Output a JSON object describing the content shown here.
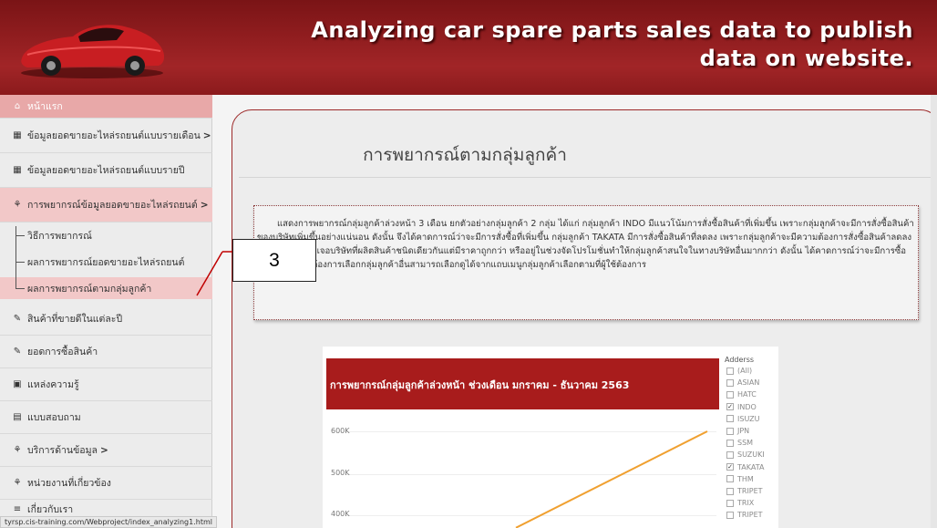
{
  "header": {
    "title_line1": "Analyzing car spare parts sales data to publish",
    "title_line2": "data on website."
  },
  "sidebar": {
    "items": [
      {
        "label": "หน้าแรก",
        "icon": "home-icon"
      },
      {
        "label": "ข้อมูลยอดขายอะไหล่รถยนต์แบบรายเดือน",
        "icon": "calendar-icon",
        "chevron": ">"
      },
      {
        "label": "ข้อมูลยอดขายอะไหล่รถยนต์แบบรายปี",
        "icon": "calendar-icon"
      },
      {
        "label": "การพยากรณ์ข้อมูลยอดขายอะไหล่รถยนต์",
        "icon": "sitemap-icon",
        "chevron": ">"
      },
      {
        "label": "สินค้าที่ขายดีในแต่ละปี",
        "icon": "wrench-icon"
      },
      {
        "label": "ยอดการซื้อสินค้า",
        "icon": "wrench-icon"
      },
      {
        "label": "แหล่งความรู้",
        "icon": "book-icon"
      },
      {
        "label": "แบบสอบถาม",
        "icon": "form-icon"
      },
      {
        "label": "บริการด้านข้อมูล",
        "icon": "sitemap-icon",
        "chevron": ">"
      },
      {
        "label": "หน่วยงานที่เกี่ยวข้อง",
        "icon": "sitemap-icon"
      },
      {
        "label": "เกี่ยวกับเรา",
        "icon": "list-icon"
      }
    ],
    "subitems": [
      {
        "label": "วิธีการพยากรณ์"
      },
      {
        "label": "ผลการพยากรณ์ยอดขายอะไหล่รถยนต์"
      },
      {
        "label": "ผลการพยากรณ์ตามกลุ่มลูกค้า"
      }
    ],
    "status_url": "tyrsp.cis-training.com/Webproject/index_analyzing1.html"
  },
  "main": {
    "title": "การพยากรณ์ตามกลุ่มลูกค้า",
    "description": "แสดงการพยากรณ์กลุ่มลูกค้าล่วงหน้า 3 เดือน ยกตัวอย่างกลุ่มลูกค้า 2 กลุ่ม ได้แก่ กลุ่มลูกค้า INDO มีแนวโน้มการสั่งซื้อสินค้าที่เพิ่มขึ้น เพราะกลุ่มลูกค้าจะมีการสั่งซื้อสินค้าของบริษัทเพิ่มขึ้นอย่างแน่นอน ดังนั้น จึงได้คาดการณ์ว่าจะมีการสั่งซื้อที่เพิ่มขึ้น กลุ่มลูกค้า TAKATA มีการสั่งซื้อสินค้าที่ลดลง เพราะกลุ่มลูกค้าจะมีความต้องการสั่งซื้อสินค้าลดลงอาจเนื่องมาจากเจอบริษัทที่ผลิตสินค้าชนิดเดียวกันแต่มีราคาถูกกว่า หรืออยู่ในช่วงจัดโปรโมชั่นทำให้กลุ่มลูกค้าสนใจในทางบริษัทอื่นมากกว่า ดังนั้น ได้คาดการณ์ว่าจะมีการซื้อลดลง ทั้งนี้ผู้ใช้ต้องการเลือกกลุ่มลูกค้าอื่นสามารถเลือกดูได้จากแถบเมนูกลุ่มลูกค้าเลือกตามที่ผู้ใช้ต้องการ"
  },
  "callout": {
    "label": "3"
  },
  "report": {
    "title": "การพยากรณ์กลุ่มลูกค้าล่วงหน้า ช่วงเดือน มกราคม - ธันวาคม 2563",
    "y_ticks": [
      "600K",
      "500K",
      "400K"
    ],
    "line_color": "#f0a030",
    "header_color": "#a81c1c"
  },
  "chart_data": {
    "type": "line",
    "title": "การพยากรณ์กลุ่มลูกค้าล่วงหน้า ช่วงเดือน มกราคม - ธันวาคม 2563",
    "y_ticks": [
      "600K",
      "500K",
      "400K"
    ],
    "ylim": [
      370000,
      600000
    ],
    "series": [
      {
        "x": [
          0,
          1
        ],
        "values": [
          370000,
          600000
        ]
      }
    ]
  },
  "slicer": {
    "title": "Adderss",
    "items": [
      {
        "label": "(All)",
        "checked": false
      },
      {
        "label": "ASIAN",
        "checked": false
      },
      {
        "label": "HATC",
        "checked": false
      },
      {
        "label": "INDO",
        "checked": true
      },
      {
        "label": "ISUZU",
        "checked": false
      },
      {
        "label": "JPN",
        "checked": false
      },
      {
        "label": "SSM",
        "checked": false
      },
      {
        "label": "SUZUKI",
        "checked": false
      },
      {
        "label": "TAKATA",
        "checked": true
      },
      {
        "label": "THM",
        "checked": false
      },
      {
        "label": "TRIPET",
        "checked": false
      },
      {
        "label": "TRIX",
        "checked": false
      },
      {
        "label": "TRIPET",
        "checked": false
      }
    ]
  }
}
